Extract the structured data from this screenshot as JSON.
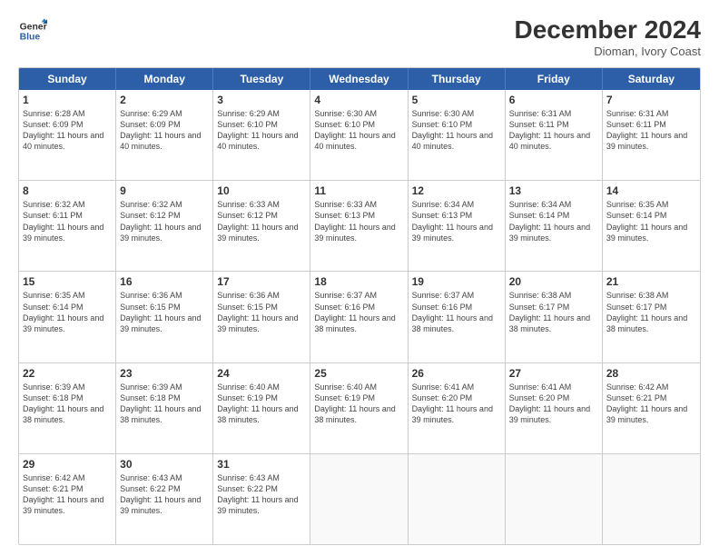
{
  "logo": {
    "line1": "General",
    "line2": "Blue"
  },
  "title": "December 2024",
  "subtitle": "Dioman, Ivory Coast",
  "header_days": [
    "Sunday",
    "Monday",
    "Tuesday",
    "Wednesday",
    "Thursday",
    "Friday",
    "Saturday"
  ],
  "weeks": [
    [
      {
        "day": "1",
        "sunrise": "6:28 AM",
        "sunset": "6:09 PM",
        "daylight": "11 hours and 40 minutes."
      },
      {
        "day": "2",
        "sunrise": "6:29 AM",
        "sunset": "6:09 PM",
        "daylight": "11 hours and 40 minutes."
      },
      {
        "day": "3",
        "sunrise": "6:29 AM",
        "sunset": "6:10 PM",
        "daylight": "11 hours and 40 minutes."
      },
      {
        "day": "4",
        "sunrise": "6:30 AM",
        "sunset": "6:10 PM",
        "daylight": "11 hours and 40 minutes."
      },
      {
        "day": "5",
        "sunrise": "6:30 AM",
        "sunset": "6:10 PM",
        "daylight": "11 hours and 40 minutes."
      },
      {
        "day": "6",
        "sunrise": "6:31 AM",
        "sunset": "6:11 PM",
        "daylight": "11 hours and 40 minutes."
      },
      {
        "day": "7",
        "sunrise": "6:31 AM",
        "sunset": "6:11 PM",
        "daylight": "11 hours and 39 minutes."
      }
    ],
    [
      {
        "day": "8",
        "sunrise": "6:32 AM",
        "sunset": "6:11 PM",
        "daylight": "11 hours and 39 minutes."
      },
      {
        "day": "9",
        "sunrise": "6:32 AM",
        "sunset": "6:12 PM",
        "daylight": "11 hours and 39 minutes."
      },
      {
        "day": "10",
        "sunrise": "6:33 AM",
        "sunset": "6:12 PM",
        "daylight": "11 hours and 39 minutes."
      },
      {
        "day": "11",
        "sunrise": "6:33 AM",
        "sunset": "6:13 PM",
        "daylight": "11 hours and 39 minutes."
      },
      {
        "day": "12",
        "sunrise": "6:34 AM",
        "sunset": "6:13 PM",
        "daylight": "11 hours and 39 minutes."
      },
      {
        "day": "13",
        "sunrise": "6:34 AM",
        "sunset": "6:14 PM",
        "daylight": "11 hours and 39 minutes."
      },
      {
        "day": "14",
        "sunrise": "6:35 AM",
        "sunset": "6:14 PM",
        "daylight": "11 hours and 39 minutes."
      }
    ],
    [
      {
        "day": "15",
        "sunrise": "6:35 AM",
        "sunset": "6:14 PM",
        "daylight": "11 hours and 39 minutes."
      },
      {
        "day": "16",
        "sunrise": "6:36 AM",
        "sunset": "6:15 PM",
        "daylight": "11 hours and 39 minutes."
      },
      {
        "day": "17",
        "sunrise": "6:36 AM",
        "sunset": "6:15 PM",
        "daylight": "11 hours and 39 minutes."
      },
      {
        "day": "18",
        "sunrise": "6:37 AM",
        "sunset": "6:16 PM",
        "daylight": "11 hours and 38 minutes."
      },
      {
        "day": "19",
        "sunrise": "6:37 AM",
        "sunset": "6:16 PM",
        "daylight": "11 hours and 38 minutes."
      },
      {
        "day": "20",
        "sunrise": "6:38 AM",
        "sunset": "6:17 PM",
        "daylight": "11 hours and 38 minutes."
      },
      {
        "day": "21",
        "sunrise": "6:38 AM",
        "sunset": "6:17 PM",
        "daylight": "11 hours and 38 minutes."
      }
    ],
    [
      {
        "day": "22",
        "sunrise": "6:39 AM",
        "sunset": "6:18 PM",
        "daylight": "11 hours and 38 minutes."
      },
      {
        "day": "23",
        "sunrise": "6:39 AM",
        "sunset": "6:18 PM",
        "daylight": "11 hours and 38 minutes."
      },
      {
        "day": "24",
        "sunrise": "6:40 AM",
        "sunset": "6:19 PM",
        "daylight": "11 hours and 38 minutes."
      },
      {
        "day": "25",
        "sunrise": "6:40 AM",
        "sunset": "6:19 PM",
        "daylight": "11 hours and 38 minutes."
      },
      {
        "day": "26",
        "sunrise": "6:41 AM",
        "sunset": "6:20 PM",
        "daylight": "11 hours and 39 minutes."
      },
      {
        "day": "27",
        "sunrise": "6:41 AM",
        "sunset": "6:20 PM",
        "daylight": "11 hours and 39 minutes."
      },
      {
        "day": "28",
        "sunrise": "6:42 AM",
        "sunset": "6:21 PM",
        "daylight": "11 hours and 39 minutes."
      }
    ],
    [
      {
        "day": "29",
        "sunrise": "6:42 AM",
        "sunset": "6:21 PM",
        "daylight": "11 hours and 39 minutes."
      },
      {
        "day": "30",
        "sunrise": "6:43 AM",
        "sunset": "6:22 PM",
        "daylight": "11 hours and 39 minutes."
      },
      {
        "day": "31",
        "sunrise": "6:43 AM",
        "sunset": "6:22 PM",
        "daylight": "11 hours and 39 minutes."
      },
      null,
      null,
      null,
      null
    ]
  ]
}
